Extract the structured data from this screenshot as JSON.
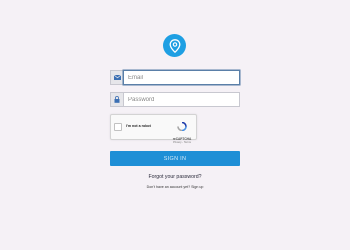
{
  "logo": {
    "icon": "map-pin-icon",
    "color": "#1e9fe3"
  },
  "form": {
    "email": {
      "icon": "envelope-icon",
      "placeholder": "Email",
      "value": ""
    },
    "password": {
      "icon": "lock-icon",
      "placeholder": "Password",
      "value": ""
    }
  },
  "recaptcha": {
    "label": "I'm not a robot",
    "brand": "reCAPTCHA",
    "links": "Privacy - Terms"
  },
  "signin": {
    "label": "SIGN IN",
    "color": "#1e8fd6"
  },
  "forgot_link": "Forgot your password?",
  "signup": {
    "prompt": "Don't have an account yet?",
    "link": "Sign up"
  }
}
